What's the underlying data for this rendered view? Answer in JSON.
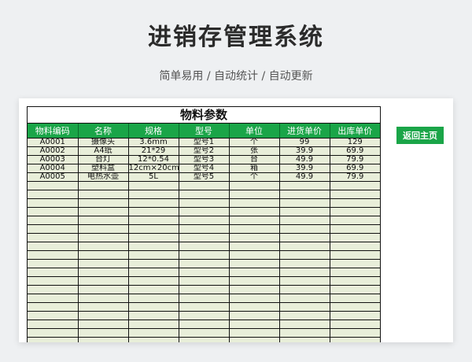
{
  "page": {
    "title": "进销存管理系统",
    "subtitle": "简单易用 / 自动统计 / 自动更新"
  },
  "sheet": {
    "title": "物料参数",
    "headers": [
      "物料编码",
      "名称",
      "规格",
      "型号",
      "单位",
      "进货单价",
      "出库单价"
    ],
    "rows": [
      [
        "A0001",
        "摄像头",
        "3.6mm",
        "型号1",
        "个",
        "99",
        "129"
      ],
      [
        "A0002",
        "A4纸",
        "21*29",
        "型号2",
        "张",
        "39.9",
        "69.9"
      ],
      [
        "A0003",
        "台灯",
        "12*0.54",
        "型号3",
        "台",
        "49.9",
        "79.9"
      ],
      [
        "A0004",
        "塑料盒",
        "12cm×20cm",
        "型号4",
        "箱",
        "39.9",
        "69.9"
      ],
      [
        "A0005",
        "电热水壶",
        "5L",
        "型号5",
        "个",
        "49.9",
        "79.9"
      ]
    ]
  },
  "actions": {
    "home_label": "返回主页"
  },
  "colors": {
    "accent": "#1aa548",
    "cell_bg": "#e8eed9",
    "page_bg": "#eef0f2"
  }
}
